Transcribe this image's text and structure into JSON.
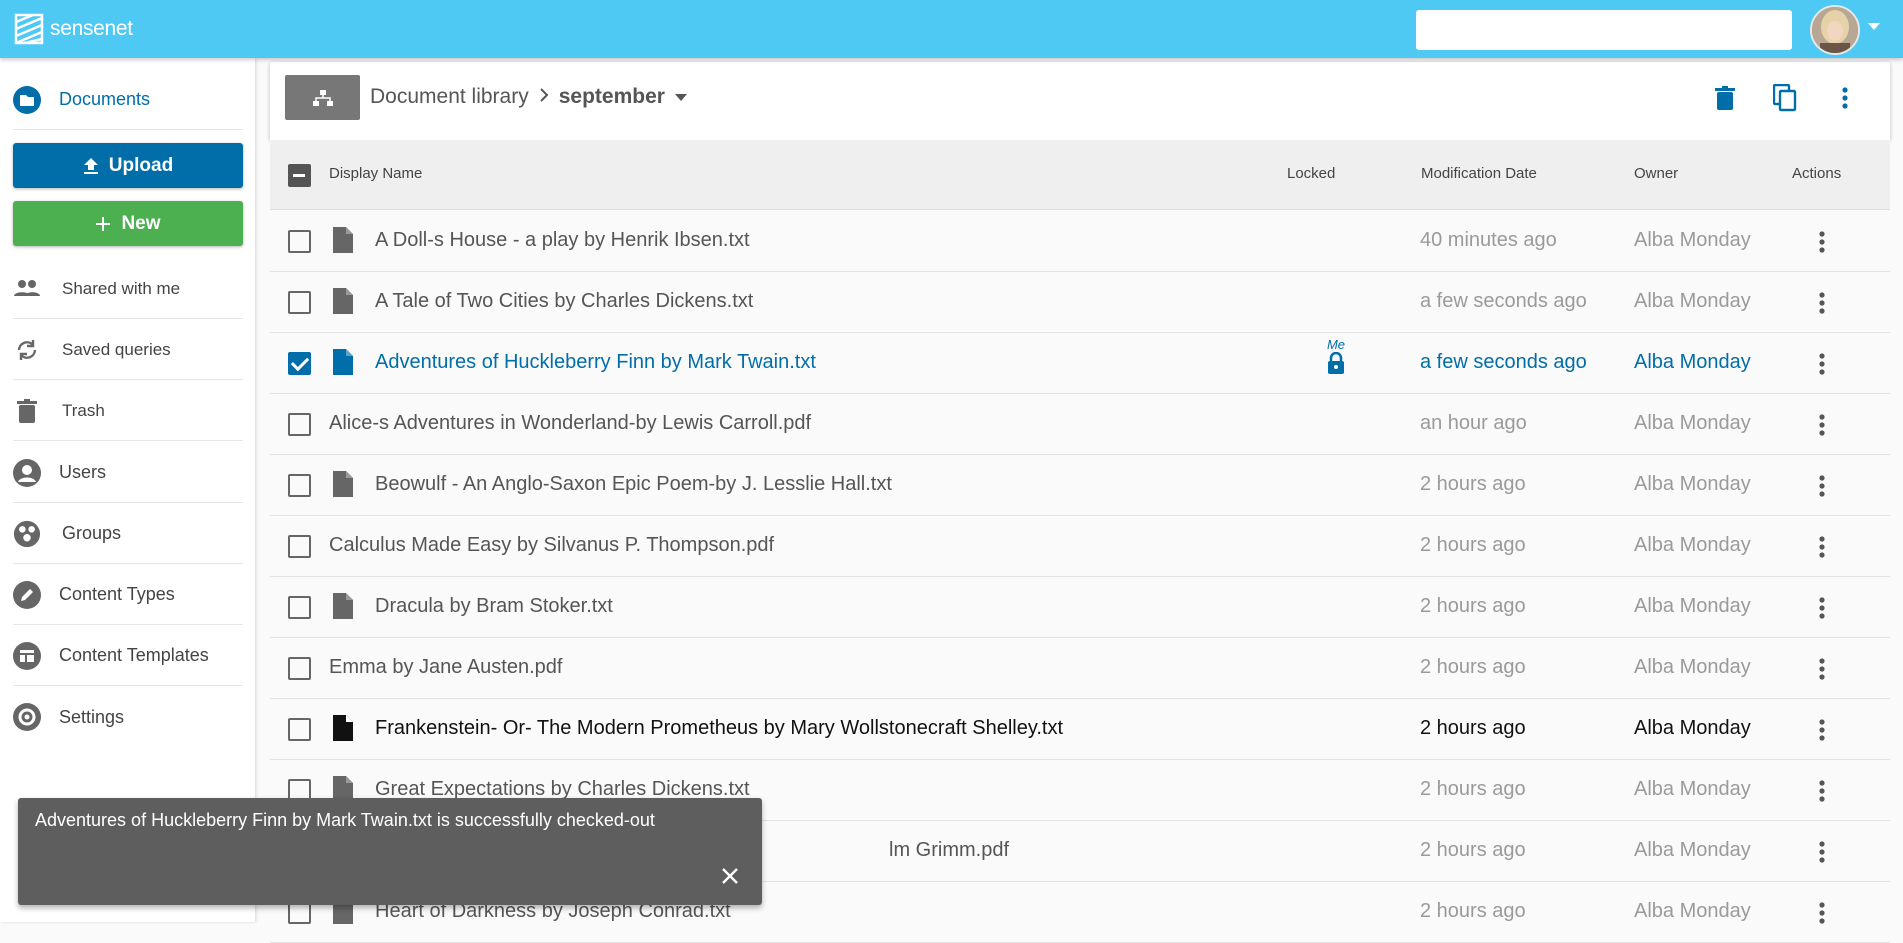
{
  "header": {
    "logo_text": "sensenet",
    "search_placeholder": "",
    "accent": "#4ec9f4"
  },
  "sidebar": {
    "items": [
      {
        "label": "Documents",
        "icon": "folder-icon"
      },
      {
        "label": "Shared with me",
        "icon": "people-icon"
      },
      {
        "label": "Saved queries",
        "icon": "refresh-icon"
      },
      {
        "label": "Trash",
        "icon": "trash-icon"
      },
      {
        "label": "Users",
        "icon": "user-icon"
      },
      {
        "label": "Groups",
        "icon": "groups-icon"
      },
      {
        "label": "Content Types",
        "icon": "pencil-icon"
      },
      {
        "label": "Content Templates",
        "icon": "template-icon"
      },
      {
        "label": "Settings",
        "icon": "gear-icon"
      }
    ],
    "upload_label": "Upload",
    "new_label": "New",
    "upload_color": "#016ea9",
    "new_color": "#4caf50"
  },
  "toolbar": {
    "breadcrumb_root": "Document library",
    "breadcrumb_current": "september"
  },
  "table": {
    "columns": {
      "name": "Display Name",
      "locked": "Locked",
      "date": "Modification Date",
      "owner": "Owner",
      "actions": "Actions"
    },
    "rows": [
      {
        "name": "A Doll-s House - a play by Henrik Ibsen.txt",
        "date": "40 minutes ago",
        "owner": "Alba Monday"
      },
      {
        "name": "A Tale of Two Cities by Charles Dickens.txt",
        "date": "a few seconds ago",
        "owner": "Alba Monday"
      },
      {
        "name": "Adventures of Huckleberry Finn by Mark Twain.txt",
        "date": "a few seconds ago",
        "owner": "Alba Monday",
        "locked_by": "Me"
      },
      {
        "name": "Alice-s Adventures in Wonderland-by Lewis Carroll.pdf",
        "date": "an hour ago",
        "owner": "Alba Monday"
      },
      {
        "name": "Beowulf - An Anglo-Saxon Epic Poem-by J. Lesslie Hall.txt",
        "date": "2 hours ago",
        "owner": "Alba Monday"
      },
      {
        "name": "Calculus Made Easy by Silvanus P. Thompson.pdf",
        "date": "2 hours ago",
        "owner": "Alba Monday"
      },
      {
        "name": "Dracula by Bram Stoker.txt",
        "date": "2 hours ago",
        "owner": "Alba Monday"
      },
      {
        "name": "Emma by Jane Austen.pdf",
        "date": "2 hours ago",
        "owner": "Alba Monday"
      },
      {
        "name": "Frankenstein- Or- The Modern Prometheus by Mary Wollstonecraft Shelley.txt",
        "date": "2 hours ago",
        "owner": "Alba Monday"
      },
      {
        "name": "Great Expectations by Charles Dickens.txt",
        "date": "2 hours ago",
        "owner": "Alba Monday"
      },
      {
        "name": "lm Grimm.pdf",
        "date": "2 hours ago",
        "owner": "Alba Monday"
      },
      {
        "name": "Heart of Darkness by Joseph Conrad.txt",
        "date": "2 hours ago",
        "owner": "Alba Monday"
      }
    ]
  },
  "snackbar": {
    "message": "Adventures of Huckleberry Finn by Mark Twain.txt is successfully checked-out"
  }
}
